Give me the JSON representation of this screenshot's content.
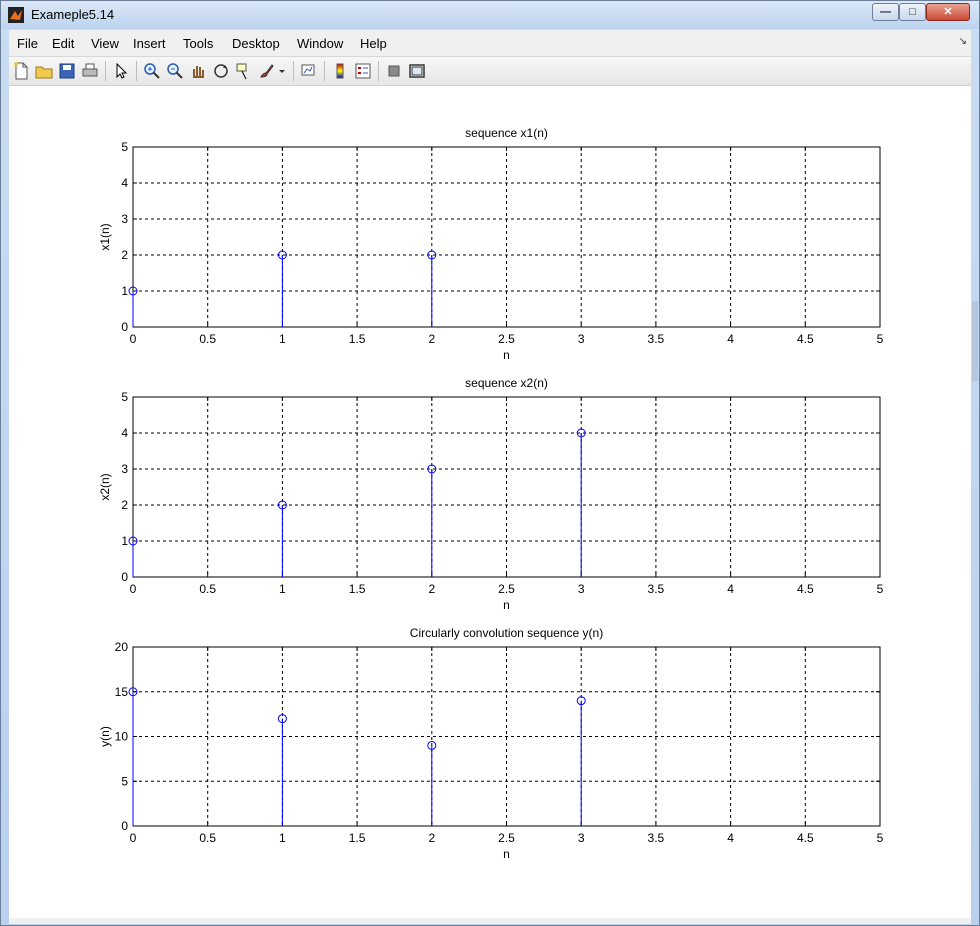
{
  "window": {
    "title": "Exameple5.14",
    "controls": {
      "minimize": "—",
      "maximize": "□",
      "close": "✕"
    }
  },
  "menu": [
    "File",
    "Edit",
    "View",
    "Insert",
    "Tools",
    "Desktop",
    "Window",
    "Help"
  ],
  "menu_corner": "↘",
  "toolbar": {
    "icons": [
      "new-figure-icon",
      "open-file-icon",
      "save-icon",
      "print-icon",
      "pointer-icon",
      "zoom-in-icon",
      "zoom-out-icon",
      "pan-icon",
      "rotate-icon",
      "data-cursor-icon",
      "brush-icon",
      "dropdown-arrow-icon",
      "link-plot-icon",
      "colorbar-icon",
      "legend-icon",
      "hide-plot-tools-icon",
      "show-plot-tools-icon"
    ]
  },
  "chart_data": [
    {
      "type": "stem",
      "title": "sequence x1(n)",
      "xlabel": "n",
      "ylabel": "x1(n)",
      "x": [
        0,
        1,
        2
      ],
      "values": [
        1,
        2,
        2
      ],
      "xlim": [
        0,
        5
      ],
      "ylim": [
        0,
        5
      ],
      "xticks": [
        "0",
        "0.5",
        "1",
        "1.5",
        "2",
        "2.5",
        "3",
        "3.5",
        "4",
        "4.5",
        "5"
      ],
      "yticks": [
        "0",
        "1",
        "2",
        "3",
        "4",
        "5"
      ],
      "grid": true,
      "color": "#0000ff"
    },
    {
      "type": "stem",
      "title": "sequence x2(n)",
      "xlabel": "n",
      "ylabel": "x2(n)",
      "x": [
        0,
        1,
        2,
        3
      ],
      "values": [
        1,
        2,
        3,
        4
      ],
      "xlim": [
        0,
        5
      ],
      "ylim": [
        0,
        5
      ],
      "xticks": [
        "0",
        "0.5",
        "1",
        "1.5",
        "2",
        "2.5",
        "3",
        "3.5",
        "4",
        "4.5",
        "5"
      ],
      "yticks": [
        "0",
        "1",
        "2",
        "3",
        "4",
        "5"
      ],
      "grid": true,
      "color": "#0000ff"
    },
    {
      "type": "stem",
      "title": "Circularly convolution sequence y(n)",
      "xlabel": "n",
      "ylabel": "y(n)",
      "x": [
        0,
        1,
        2,
        3
      ],
      "values": [
        15,
        12,
        9,
        14
      ],
      "xlim": [
        0,
        5
      ],
      "ylim": [
        0,
        20
      ],
      "xticks": [
        "0",
        "0.5",
        "1",
        "1.5",
        "2",
        "2.5",
        "3",
        "3.5",
        "4",
        "4.5",
        "5"
      ],
      "yticks": [
        "0",
        "5",
        "10",
        "15",
        "20"
      ],
      "grid": true,
      "color": "#0000ff"
    }
  ]
}
